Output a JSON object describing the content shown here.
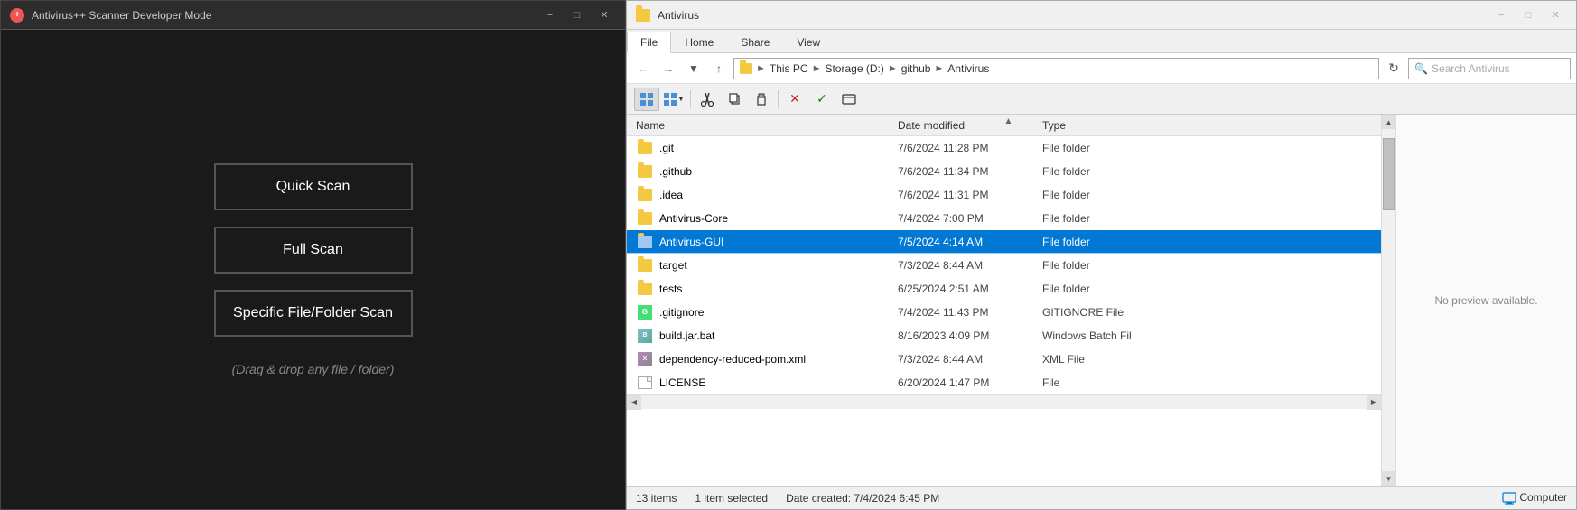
{
  "left": {
    "title": "Antivirus++ Scanner Developer Mode",
    "buttons": {
      "quick_scan": "Quick Scan",
      "full_scan": "Full Scan",
      "specific_scan": "Specific File/Folder Scan"
    },
    "drag_drop": "(Drag & drop any file / folder)"
  },
  "right": {
    "title": "Antivirus",
    "tabs": {
      "file": "File",
      "home": "Home",
      "share": "Share",
      "view": "View"
    },
    "breadcrumb": {
      "this_pc": "This PC",
      "storage": "Storage (D:)",
      "github": "github",
      "antivirus": "Antivirus"
    },
    "search_placeholder": "Search Antivirus",
    "columns": {
      "name": "Name",
      "date_modified": "Date modified",
      "type": "Type"
    },
    "files": [
      {
        "name": ".git",
        "date": "7/6/2024 11:28 PM",
        "type": "File folder",
        "icon": "folder"
      },
      {
        "name": ".github",
        "date": "7/6/2024 11:34 PM",
        "type": "File folder",
        "icon": "folder"
      },
      {
        "name": ".idea",
        "date": "7/6/2024 11:31 PM",
        "type": "File folder",
        "icon": "folder"
      },
      {
        "name": "Antivirus-Core",
        "date": "7/4/2024 7:00 PM",
        "type": "File folder",
        "icon": "folder"
      },
      {
        "name": "Antivirus-GUI",
        "date": "7/5/2024 4:14 AM",
        "type": "File folder",
        "icon": "folder",
        "selected": true
      },
      {
        "name": "target",
        "date": "7/3/2024 8:44 AM",
        "type": "File folder",
        "icon": "folder"
      },
      {
        "name": "tests",
        "date": "6/25/2024 2:51 AM",
        "type": "File folder",
        "icon": "folder"
      },
      {
        "name": ".gitignore",
        "date": "7/4/2024 11:43 PM",
        "type": "GITIGNORE File",
        "icon": "gitignore"
      },
      {
        "name": "build.jar.bat",
        "date": "8/16/2023 4:09 PM",
        "type": "Windows Batch Fil",
        "icon": "bat"
      },
      {
        "name": "dependency-reduced-pom.xml",
        "date": "7/3/2024 8:44 AM",
        "type": "XML File",
        "icon": "xml"
      },
      {
        "name": "LICENSE",
        "date": "6/20/2024 1:47 PM",
        "type": "File",
        "icon": "file"
      }
    ],
    "status": {
      "items_count": "13 items",
      "selected": "1 item selected",
      "date_created_label": "Date created:",
      "date_created_value": "7/4/2024 6:45 PM",
      "computer_label": "Computer"
    },
    "no_preview": "No preview available."
  }
}
